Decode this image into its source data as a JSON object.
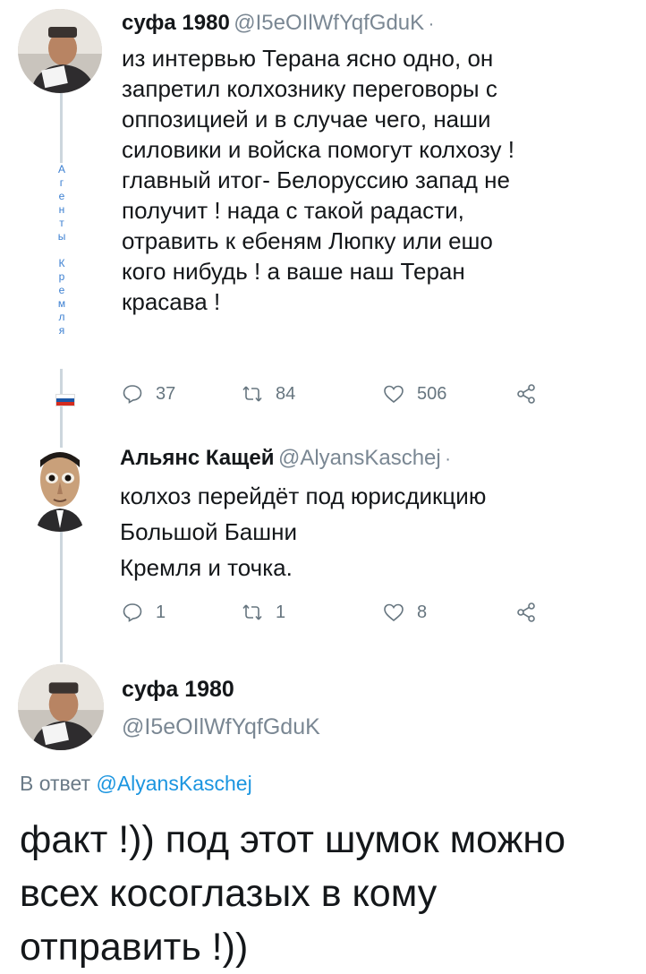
{
  "tweet1": {
    "name": "суфа 1980",
    "handle": "@I5eOIlWfYqfGduK",
    "separator": "·",
    "text": "из интервью Терана ясно одно, он\nзапретил колхознику переговоры с\nоппозицией и в случае чего, наши\nсиловики и войска помогут колхозу !\nглавный итог- Белоруссию запад не\nполучит ! нада с такой радасти,\nотравить к ебеням Люпку  или ешо\nкого нибудь ! а ваше наш Теран\nкрасава !",
    "replies": "37",
    "retweets": "84",
    "likes": "506"
  },
  "side_label": {
    "letters": [
      "А",
      "г",
      "е",
      "н",
      "т",
      "ы",
      "",
      "К",
      "р",
      "е",
      "м",
      "л",
      "я"
    ]
  },
  "flag_colors": [
    "#ffffff",
    "#1c57a5",
    "#d52b1e"
  ],
  "tweet2": {
    "name": "Альянс Кащей",
    "handle": "@AlyansKaschej",
    "separator": "·",
    "text": "колхоз перейдёт под юрисдикцию\nБольшой Башни\n Кремля и точка.",
    "replies": "1",
    "retweets": "1",
    "likes": "8"
  },
  "tweet3": {
    "name": "суфа 1980",
    "handle": "@I5eOIlWfYqfGduK",
    "reply_prefix": "В ответ",
    "reply_handle": "@AlyansKaschej",
    "text": "факт !)) под этот шумок можно всех косоглазых в кому отправить !))"
  },
  "icons": {
    "reply": "reply-icon",
    "retweet": "retweet-icon",
    "like": "heart-icon",
    "share": "share-icon"
  },
  "colors": {
    "accent": "#1b95e0",
    "muted": "#66757f",
    "thread": "#ccd6dd"
  }
}
